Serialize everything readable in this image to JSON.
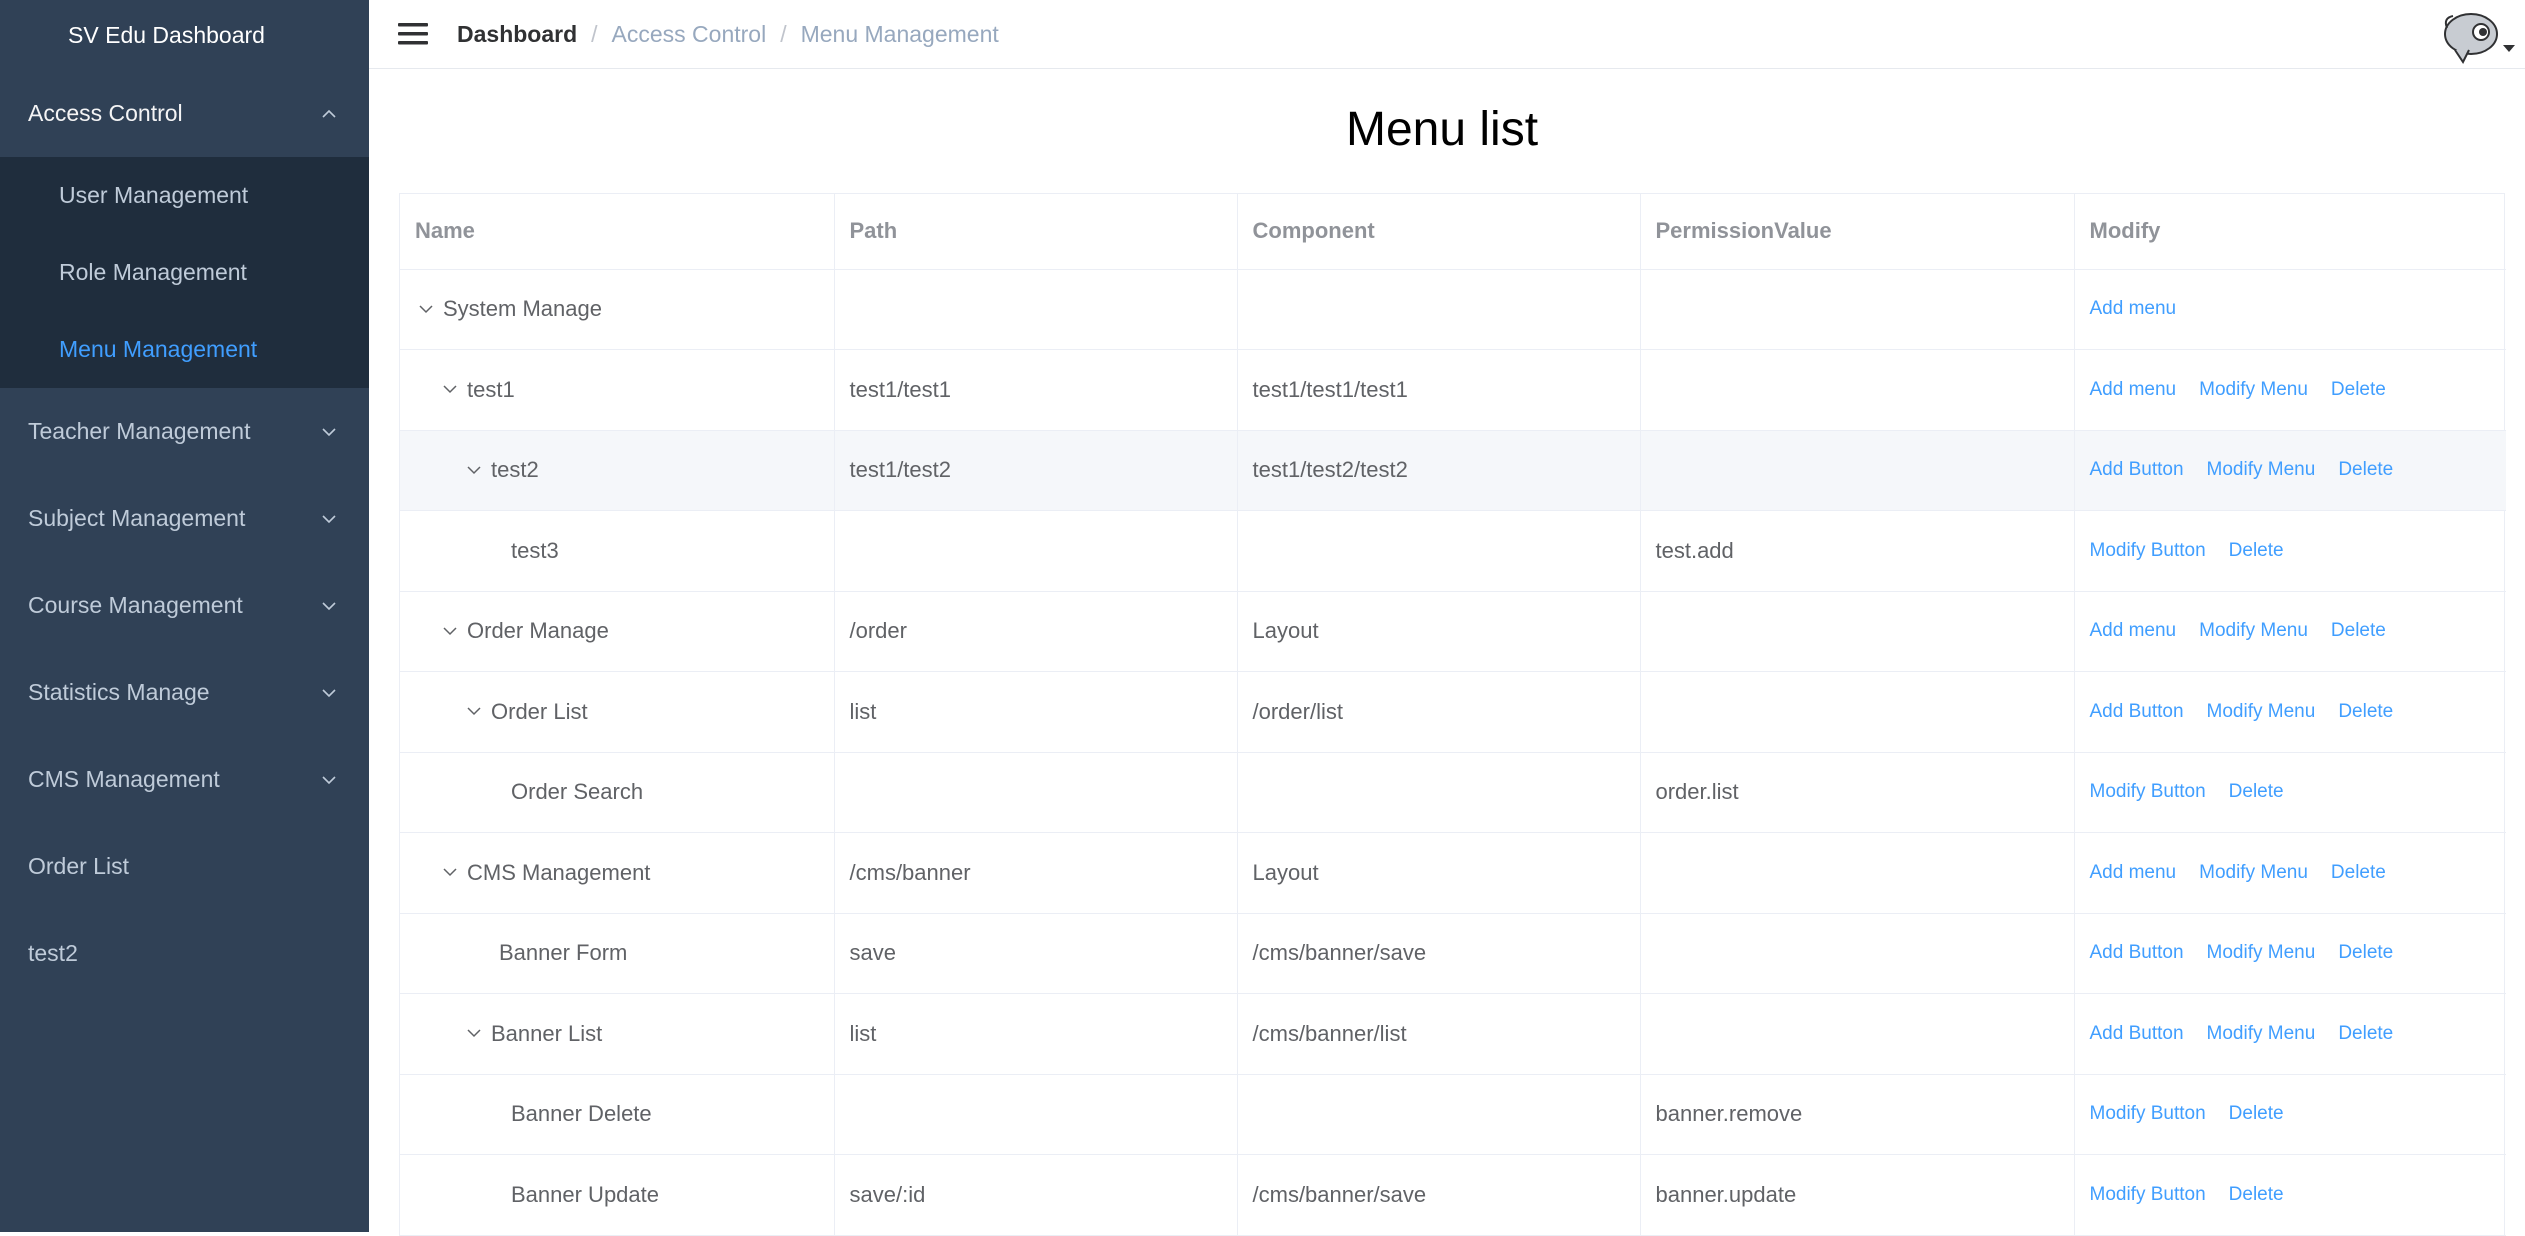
{
  "sidebar": {
    "brand": "SV Edu Dashboard",
    "access_control": "Access Control",
    "sub_items": [
      "User Management",
      "Role Management",
      "Menu Management"
    ],
    "items": [
      "Teacher Management",
      "Subject Management",
      "Course Management",
      "Statistics Manage",
      "CMS Management",
      "Order List",
      "test2"
    ],
    "active_color": "#409eff",
    "bg_color": "#304156"
  },
  "breadcrumb": [
    "Dashboard",
    "Access Control",
    "Menu Management"
  ],
  "page": {
    "title": "Menu list"
  },
  "table": {
    "headers": [
      "Name",
      "Path",
      "Component",
      "PermissionValue",
      "Modify"
    ],
    "rows": [
      {
        "name": "System Manage",
        "path": "",
        "component": "",
        "permission": "",
        "actions": [
          "Add menu"
        ]
      },
      {
        "name": "test1",
        "path": "test1/test1",
        "component": "test1/test1/test1",
        "permission": "",
        "actions": [
          "Add menu",
          "Modify Menu",
          "Delete"
        ]
      },
      {
        "name": "test2",
        "path": "test1/test2",
        "component": "test1/test2/test2",
        "permission": "",
        "actions": [
          "Add Button",
          "Modify Menu",
          "Delete"
        ]
      },
      {
        "name": "test3",
        "path": "",
        "component": "",
        "permission": "test.add",
        "actions": [
          "Modify Button",
          "Delete"
        ]
      },
      {
        "name": "Order Manage",
        "path": "/order",
        "component": "Layout",
        "permission": "",
        "actions": [
          "Add menu",
          "Modify Menu",
          "Delete"
        ]
      },
      {
        "name": "Order List",
        "path": "list",
        "component": "/order/list",
        "permission": "",
        "actions": [
          "Add Button",
          "Modify Menu",
          "Delete"
        ]
      },
      {
        "name": "Order Search",
        "path": "",
        "component": "",
        "permission": "order.list",
        "actions": [
          "Modify Button",
          "Delete"
        ]
      },
      {
        "name": "CMS Management",
        "path": "/cms/banner",
        "component": "Layout",
        "permission": "",
        "actions": [
          "Add menu",
          "Modify Menu",
          "Delete"
        ]
      },
      {
        "name": "Banner Form",
        "path": "save",
        "component": "/cms/banner/save",
        "permission": "",
        "actions": [
          "Add Button",
          "Modify Menu",
          "Delete"
        ]
      },
      {
        "name": "Banner List",
        "path": "list",
        "component": "/cms/banner/list",
        "permission": "",
        "actions": [
          "Add Button",
          "Modify Menu",
          "Delete"
        ]
      },
      {
        "name": "Banner Delete",
        "path": "",
        "component": "",
        "permission": "banner.remove",
        "actions": [
          "Modify Button",
          "Delete"
        ]
      },
      {
        "name": "Banner Update",
        "path": "save/:id",
        "component": "/cms/banner/save",
        "permission": "banner.update",
        "actions": [
          "Modify Button",
          "Delete"
        ]
      }
    ]
  }
}
